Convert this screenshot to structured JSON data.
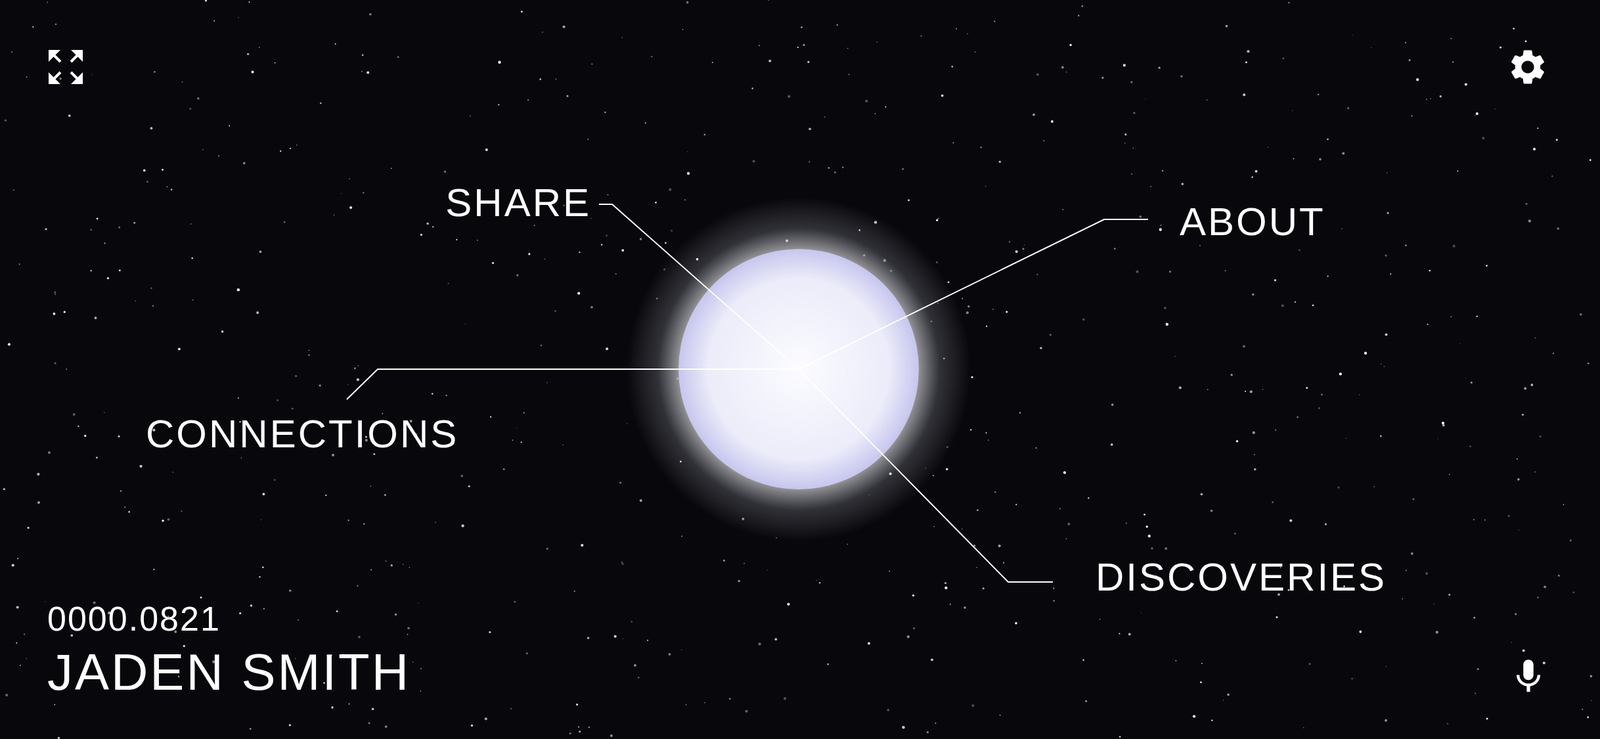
{
  "menu": [
    {
      "label": "SHARE"
    },
    {
      "label": "ABOUT"
    },
    {
      "label": "CONNECTIONS"
    },
    {
      "label": "DISCOVERIES"
    }
  ],
  "profile": {
    "id": "0000.0821",
    "name": "JADEN SMITH"
  }
}
